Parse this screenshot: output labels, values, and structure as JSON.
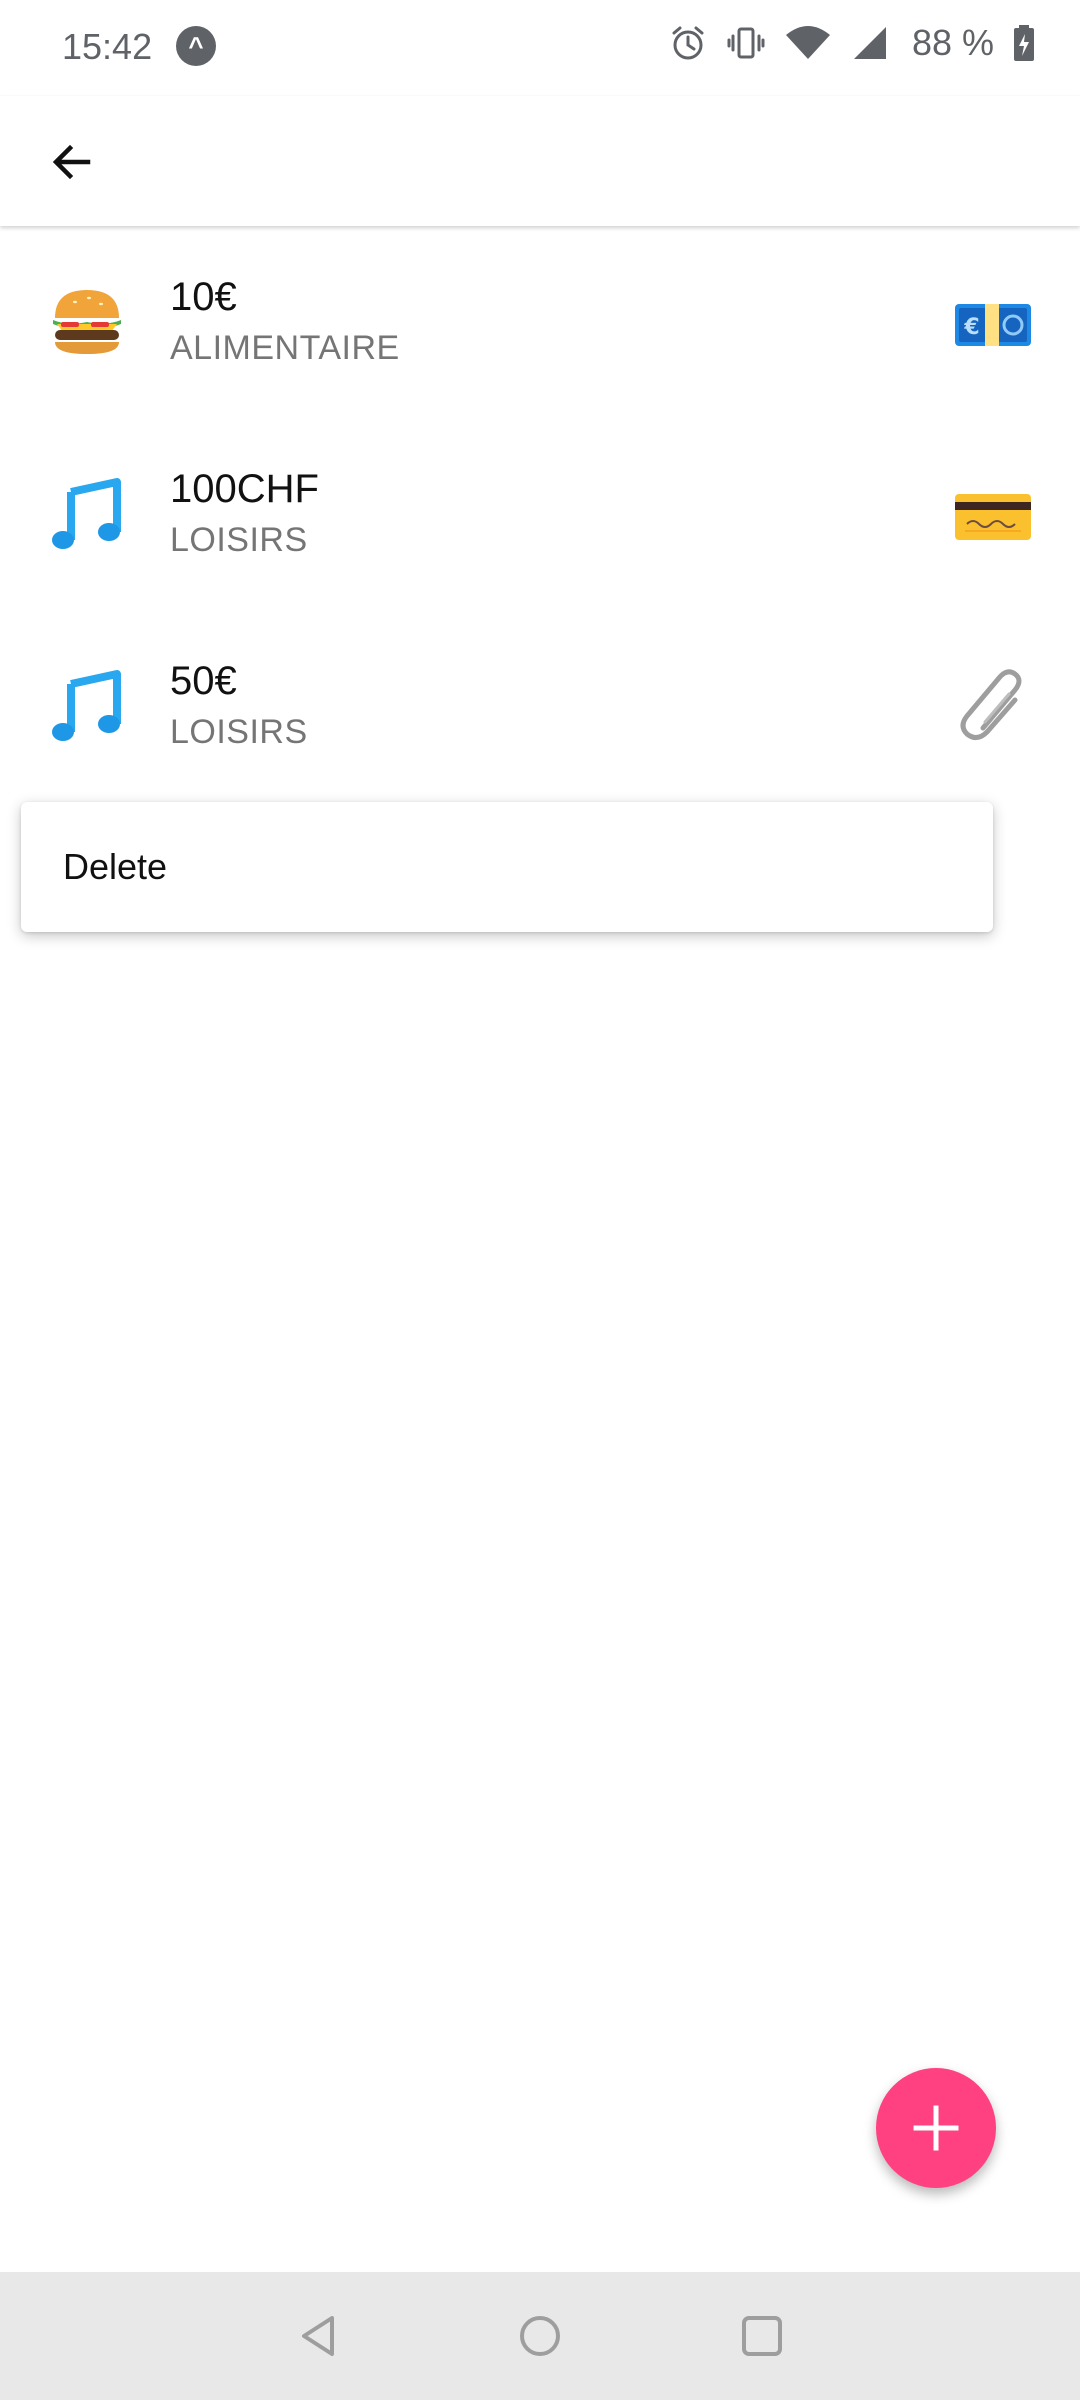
{
  "status_bar": {
    "time": "15:42",
    "app_icon": "arrow-up-circle-icon",
    "icons": [
      "alarm-icon",
      "vibrate-icon",
      "wifi-icon",
      "cell-signal-icon",
      "battery-charging-icon"
    ],
    "battery_text": "88 %"
  },
  "app_bar": {
    "back_icon": "arrow-back-icon"
  },
  "transactions": [
    {
      "amount": "10€",
      "category": "ALIMENTAIRE",
      "category_icon": "hamburger-icon",
      "payment_icon": "euro-banknote-icon"
    },
    {
      "amount": "100CHF",
      "category": "LOISIRS",
      "category_icon": "music-note-icon",
      "payment_icon": "credit-card-icon"
    },
    {
      "amount": "50€",
      "category": "LOISIRS",
      "category_icon": "music-note-icon",
      "payment_icon": "paperclip-icon"
    }
  ],
  "context_menu": {
    "items": [
      "Delete"
    ]
  },
  "fab": {
    "icon": "plus-icon"
  },
  "nav_bar": {
    "back_icon": "nav-back-icon",
    "home_icon": "nav-home-icon",
    "recents_icon": "nav-recents-icon"
  },
  "colors": {
    "accent": "#ff4081",
    "status_text": "#5f6368",
    "secondary_text": "#757575",
    "nav_background": "#e8e8e8"
  }
}
